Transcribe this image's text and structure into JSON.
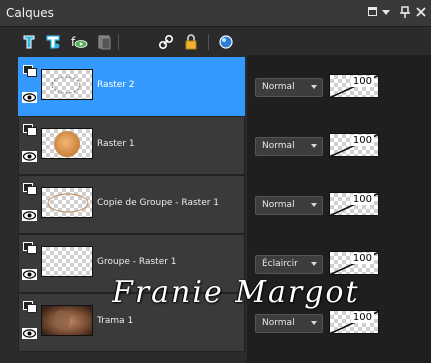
{
  "window": {
    "title": "Calques",
    "controls": [
      "square-icon",
      "dropdown-icon",
      "pin-icon",
      "close-icon"
    ]
  },
  "toolbar": {
    "icons": [
      "new-raster-layer-icon",
      "new-vector-layer-icon",
      "new-adjustment-layer-icon",
      "new-mask-layer-icon",
      "link-icon",
      "lock-icon",
      "view-icon"
    ]
  },
  "layers": [
    {
      "name": "Raster 2",
      "selected": true,
      "thumbnail": "sketch-ellipse",
      "blend_mode": "Normal",
      "opacity": "100"
    },
    {
      "name": "Raster 1",
      "selected": false,
      "thumbnail": "orange-disc",
      "blend_mode": "Normal",
      "opacity": "100"
    },
    {
      "name": "Copie de Groupe - Raster 1",
      "selected": false,
      "thumbnail": "thin-ellipse",
      "blend_mode": "Normal",
      "opacity": "100"
    },
    {
      "name": "Groupe - Raster 1",
      "selected": false,
      "thumbnail": "transparent",
      "blend_mode": "Éclaircir",
      "opacity": "100"
    },
    {
      "name": "Trama 1",
      "selected": false,
      "thumbnail": "photo-brown",
      "blend_mode": "Normal",
      "opacity": "100"
    }
  ],
  "watermark": "Franie Margot",
  "colors": {
    "selected": "#3399ff",
    "panel": "#2b2b2b",
    "row": "#3a3a3a"
  }
}
